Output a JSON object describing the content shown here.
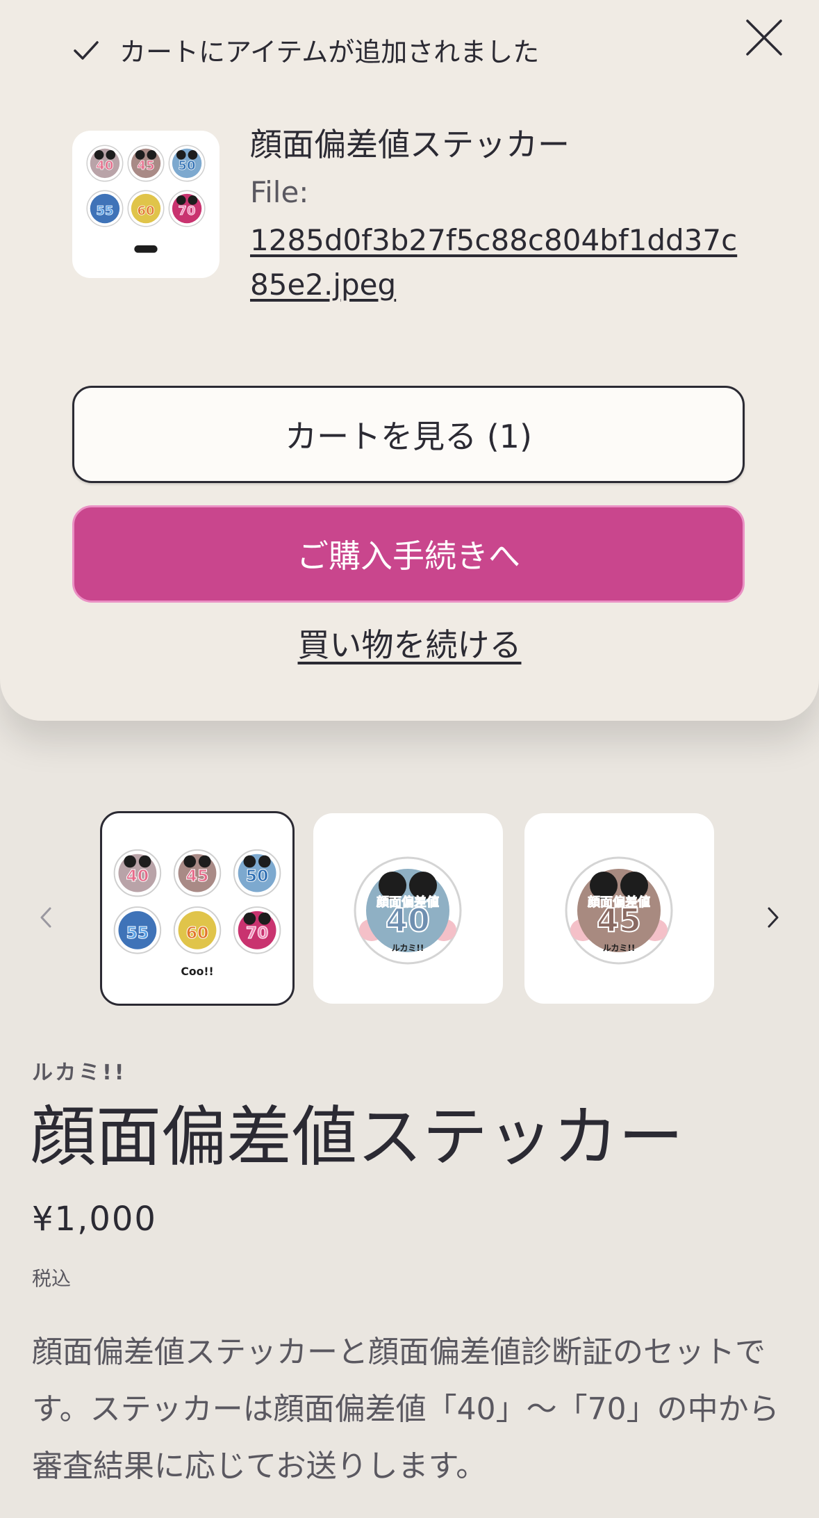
{
  "popup": {
    "added_message": "カートにアイテムが追加されました",
    "item": {
      "title": "顔面偏差値ステッカー",
      "file_label": "File:",
      "file_name": "1285d0f3b27f5c88c804bf1dd37c85e2.jpeg"
    },
    "view_cart_label": "カートを見る (1)",
    "checkout_label": "ご購入手続きへ",
    "continue_label": "買い物を続ける"
  },
  "gallery": {
    "thumbnails": [
      {
        "numbers": [
          "40",
          "45",
          "50",
          "55",
          "60",
          "70"
        ],
        "brand": "Coo!!"
      },
      {
        "number": "40",
        "caption": "顔面偏差値",
        "brand": "ルカミ!!"
      },
      {
        "number": "45",
        "caption": "顔面偏差値",
        "brand": "ルカミ!!"
      }
    ]
  },
  "product": {
    "vendor": "ルカミ!!",
    "title": "顔面偏差値ステッカー",
    "price": "¥1,000",
    "tax_note": "税込",
    "description": "顔面偏差値ステッカーと顔面偏差値診断証のセットです。ステッカーは顔面偏差値「40」〜「70」の中から審査結果に応じてお送りします。"
  },
  "colors": {
    "accent": "#c9468d",
    "background": "#eae6e0",
    "popup_background": "#f0ebe4",
    "text": "#2b2a33"
  },
  "icons": {
    "check": "check-icon",
    "close": "close-icon",
    "prev": "chevron-left-icon",
    "next": "chevron-right-icon"
  }
}
